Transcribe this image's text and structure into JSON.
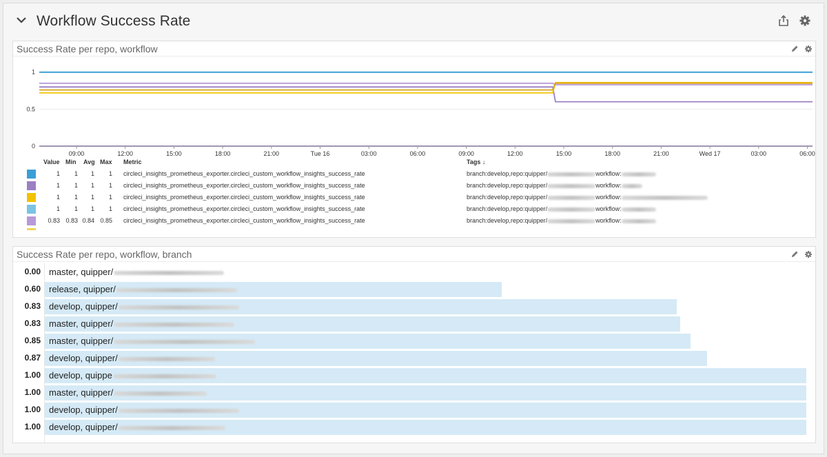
{
  "group": {
    "title": "Workflow Success Rate"
  },
  "timeseries": {
    "title": "Success Rate per repo, workflow",
    "legend_headers": {
      "value": "Value",
      "min": "Min",
      "avg": "Avg",
      "max": "Max",
      "metric": "Metric",
      "tags": "Tags ↓"
    },
    "legend_rows": [
      {
        "color": "#3a9fd6",
        "value": "1",
        "min": "1",
        "avg": "1",
        "max": "1",
        "metric": "circleci_insights_prometheus_exporter.circleci_custom_workflow_insights_success_rate",
        "tags_a": "branch:develop,repo:quipper/",
        "tags_b": "workflow:"
      },
      {
        "color": "#9b80c2",
        "value": "1",
        "min": "1",
        "avg": "1",
        "max": "1",
        "metric": "circleci_insights_prometheus_exporter.circleci_custom_workflow_insights_success_rate",
        "tags_a": "branch:develop,repo:quipper/",
        "tags_b": "workflow:"
      },
      {
        "color": "#f2c200",
        "value": "1",
        "min": "1",
        "avg": "1",
        "max": "1",
        "metric": "circleci_insights_prometheus_exporter.circleci_custom_workflow_insights_success_rate",
        "tags_a": "branch:develop,repo:quipper/",
        "tags_b": "workflow:"
      },
      {
        "color": "#7cc3e4",
        "value": "1",
        "min": "1",
        "avg": "1",
        "max": "1",
        "metric": "circleci_insights_prometheus_exporter.circleci_custom_workflow_insights_success_rate",
        "tags_a": "branch:develop,repo:quipper/",
        "tags_b": "workflow:"
      },
      {
        "color": "#b79ad8",
        "value": "0.83",
        "min": "0.83",
        "avg": "0.84",
        "max": "0.85",
        "metric": "circleci_insights_prometheus_exporter.circleci_custom_workflow_insights_success_rate",
        "tags_a": "branch:develop,repo:quipper/",
        "tags_b": "workflow:"
      }
    ]
  },
  "chart_data": {
    "type": "line",
    "x": [
      "09:00",
      "12:00",
      "15:00",
      "18:00",
      "21:00",
      "Tue 16",
      "03:00",
      "06:00",
      "09:00",
      "12:00",
      "15:00",
      "18:00",
      "21:00",
      "Wed 17",
      "03:00",
      "06:00"
    ],
    "y_ticks": [
      "0",
      "0.5",
      "1"
    ],
    "ylim": [
      0,
      1.1
    ],
    "grid": true,
    "series": [
      {
        "color": "#3a9fd6",
        "values": [
          1,
          1,
          1,
          1,
          1,
          1,
          1,
          1,
          1,
          1,
          1,
          1,
          1,
          1,
          1,
          1
        ]
      },
      {
        "color": "#9b80c2",
        "values": [
          0.8,
          0.8,
          0.8,
          0.8,
          0.8,
          0.8,
          0.8,
          0.8,
          0.8,
          0.8,
          0.6,
          0.6,
          0.6,
          0.6,
          0.6,
          0.6
        ]
      },
      {
        "color": "#f2c200",
        "values": [
          0.72,
          0.72,
          0.72,
          0.72,
          0.72,
          0.72,
          0.72,
          0.72,
          0.72,
          0.72,
          0.86,
          0.86,
          0.86,
          0.86,
          0.86,
          0.86
        ]
      },
      {
        "color": "#b79ad8",
        "values": [
          0.85,
          0.85,
          0.85,
          0.85,
          0.85,
          0.85,
          0.85,
          0.85,
          0.85,
          0.85,
          0.83,
          0.83,
          0.83,
          0.83,
          0.83,
          0.83
        ]
      },
      {
        "color": "#d9a21a",
        "values": [
          0.76,
          0.76,
          0.76,
          0.76,
          0.76,
          0.76,
          0.76,
          0.76,
          0.76,
          0.76,
          0.85,
          0.85,
          0.85,
          0.85,
          0.85,
          0.85
        ]
      },
      {
        "color": "#8b6fb8",
        "values": [
          0,
          0,
          0,
          0,
          0,
          0,
          0,
          0,
          0,
          0,
          0,
          0,
          0,
          0,
          0,
          0
        ]
      }
    ]
  },
  "toplist": {
    "title": "Success Rate per repo, workflow, branch",
    "rows": [
      {
        "value": "0.00",
        "fraction": 0.0,
        "label": "master, quipper/"
      },
      {
        "value": "0.60",
        "fraction": 0.6,
        "label": "release, quipper/"
      },
      {
        "value": "0.83",
        "fraction": 0.83,
        "label": "develop, quipper/"
      },
      {
        "value": "0.83",
        "fraction": 0.834,
        "label": "master, quipper/"
      },
      {
        "value": "0.85",
        "fraction": 0.848,
        "label": "master, quipper/"
      },
      {
        "value": "0.87",
        "fraction": 0.87,
        "label": "develop, quipper/"
      },
      {
        "value": "1.00",
        "fraction": 1.0,
        "label": "develop, quippe"
      },
      {
        "value": "1.00",
        "fraction": 1.0,
        "label": "master, quipper/"
      },
      {
        "value": "1.00",
        "fraction": 1.0,
        "label": "develop, quipper/"
      },
      {
        "value": "1.00",
        "fraction": 1.0,
        "label": "develop, quipper/"
      }
    ]
  }
}
